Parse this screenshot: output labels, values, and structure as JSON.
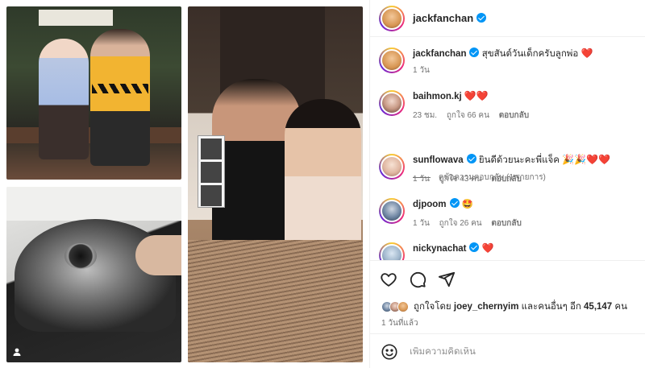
{
  "header": {
    "username": "jackfanchan"
  },
  "caption": {
    "username": "jackfanchan",
    "text": "สุขสันต์วันเด็กครับลูกพ่อ",
    "emoji": "❤️",
    "time": "1 วัน"
  },
  "comments": [
    {
      "username": "baihmon.kj",
      "verified": false,
      "text": "",
      "emoji": "❤️❤️",
      "time": "23 ชม.",
      "likes": "ถูกใจ 66 คน",
      "reply": "ตอบกลับ"
    },
    {
      "username": "sunflowava",
      "verified": true,
      "text": "ยินดีด้วยนะคะพี่แจ็ค",
      "emoji": "🎉🎉❤️❤️",
      "time": "1 วัน",
      "likes": "ถูกใจ 43 คน",
      "reply": "ตอบกลับ"
    },
    {
      "username": "djpoom",
      "verified": true,
      "text": "",
      "emoji": "🤩",
      "time": "1 วัน",
      "likes": "ถูกใจ 26 คน",
      "reply": "ตอบกลับ"
    },
    {
      "username": "nickynachat",
      "verified": true,
      "text": "",
      "emoji": "❤️"
    }
  ],
  "view_replies": "ดูข้อความตอบกลับ (1 รายการ)",
  "likes_summary": {
    "prefix": "ถูกใจโดย",
    "user": "joey_chernyim",
    "middle": "และคนอื่นๆ อีก",
    "count": "45,147",
    "suffix": "คน"
  },
  "posted": "1 วันที่แล้ว",
  "add_comment_placeholder": "เพิ่มความคิดเห็น",
  "icons": {
    "like": "heart-icon",
    "comment": "comment-icon",
    "share": "share-icon",
    "emoji": "emoji-icon",
    "tag": "user-tag-icon"
  },
  "colors": {
    "verified": "#0095f6",
    "heart": "#ed4956",
    "muted": "#737373"
  }
}
